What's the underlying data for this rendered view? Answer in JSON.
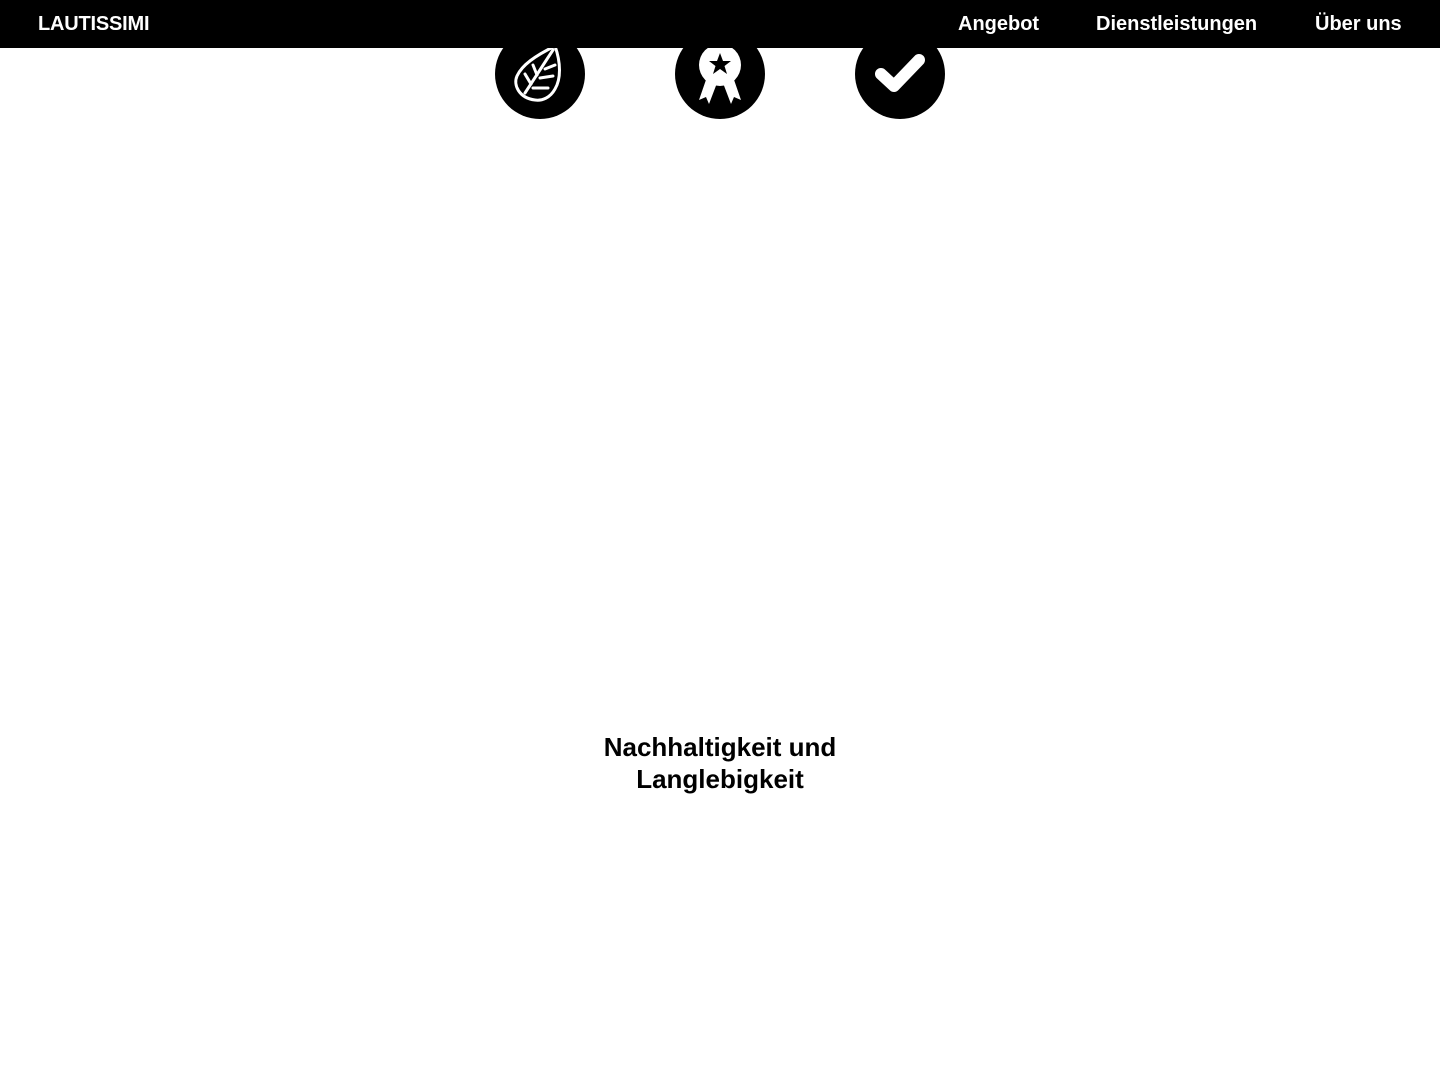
{
  "header": {
    "brand": "LAUTISSIMI",
    "nav": [
      {
        "label": "Angebot"
      },
      {
        "label": "Dienstleistungen"
      },
      {
        "label": "Über uns"
      }
    ]
  },
  "features": {
    "icons": [
      {
        "icon": "leaf-icon"
      },
      {
        "icon": "award-ribbon-icon"
      },
      {
        "icon": "checkmark-icon"
      }
    ],
    "heading_line1": "Nachhaltigkeit und",
    "heading_line2": "Langlebigkeit"
  },
  "colors": {
    "header_bg": "#000000",
    "header_text": "#ffffff",
    "page_bg": "#ffffff",
    "icon_bg": "#000000"
  }
}
